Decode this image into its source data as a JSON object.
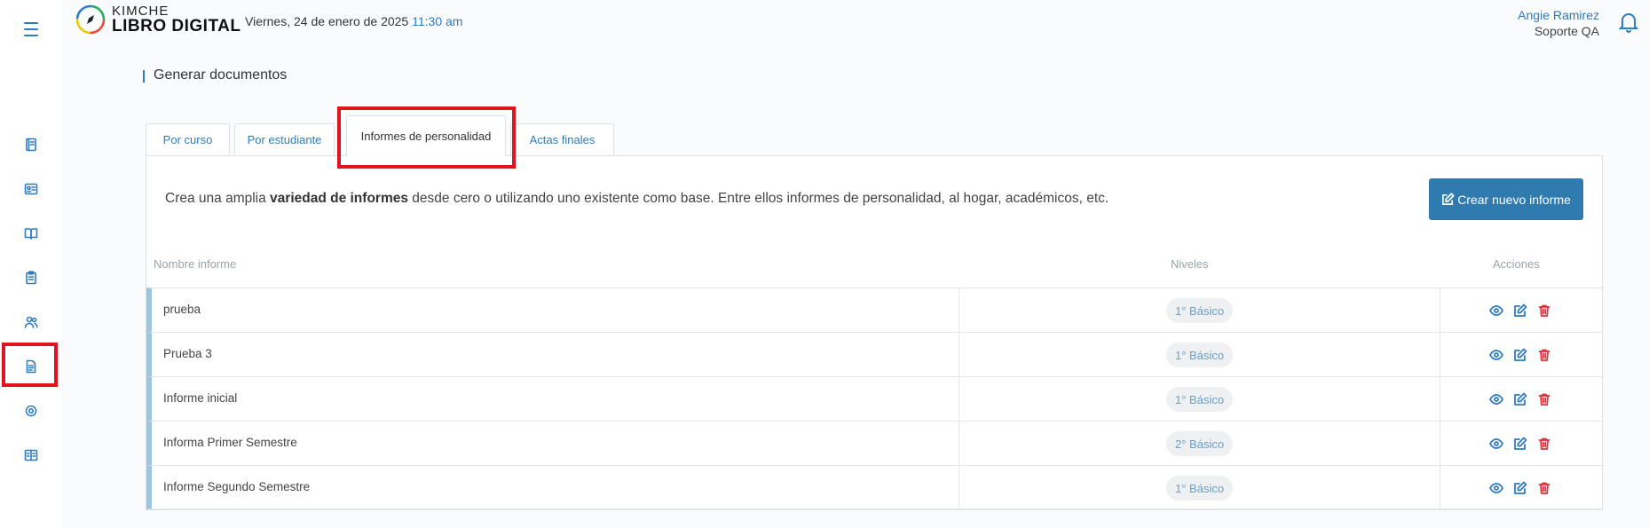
{
  "header": {
    "logo_top": "KIMCHE",
    "logo_bottom": "LIBRO DIGITAL",
    "date": "Viernes, 24 de enero de 2025",
    "time": "11:30 am",
    "user_name": "Angie Ramirez",
    "user_role": "Soporte QA"
  },
  "sidebar": {
    "icons": [
      "book-icon",
      "id-card-icon",
      "open-book-icon",
      "clipboard-icon",
      "users-icon",
      "document-icon",
      "settings-icon",
      "reader-icon"
    ],
    "highlighted": "document-icon"
  },
  "page": {
    "title": "Generar documentos"
  },
  "tabs": [
    {
      "label": "Por curso"
    },
    {
      "label": "Por estudiante"
    },
    {
      "label": "Informes de personalidad",
      "active": true
    },
    {
      "label": "Actas finales"
    }
  ],
  "panel": {
    "intro_pre": "Crea una amplia ",
    "intro_bold": "variedad de informes",
    "intro_post": " desde cero o utilizando uno existente como base. Entre ellos informes de personalidad, al hogar, académicos, etc.",
    "create_button": "Crear nuevo informe"
  },
  "table": {
    "columns": [
      "Nombre informe",
      "Niveles",
      "Acciones"
    ],
    "rows": [
      {
        "name": "prueba",
        "level": "1° Básico"
      },
      {
        "name": "Prueba 3",
        "level": "1° Básico"
      },
      {
        "name": "Informe inicial",
        "level": "1° Básico"
      },
      {
        "name": "Informa Primer Semestre",
        "level": "2° Básico"
      },
      {
        "name": "Informe Segundo Semestre",
        "level": "1° Básico"
      }
    ]
  },
  "colors": {
    "accent": "#2f7bbf",
    "button": "#2f7bb0",
    "highlight": "#e0141e",
    "delete": "#d9343b"
  }
}
